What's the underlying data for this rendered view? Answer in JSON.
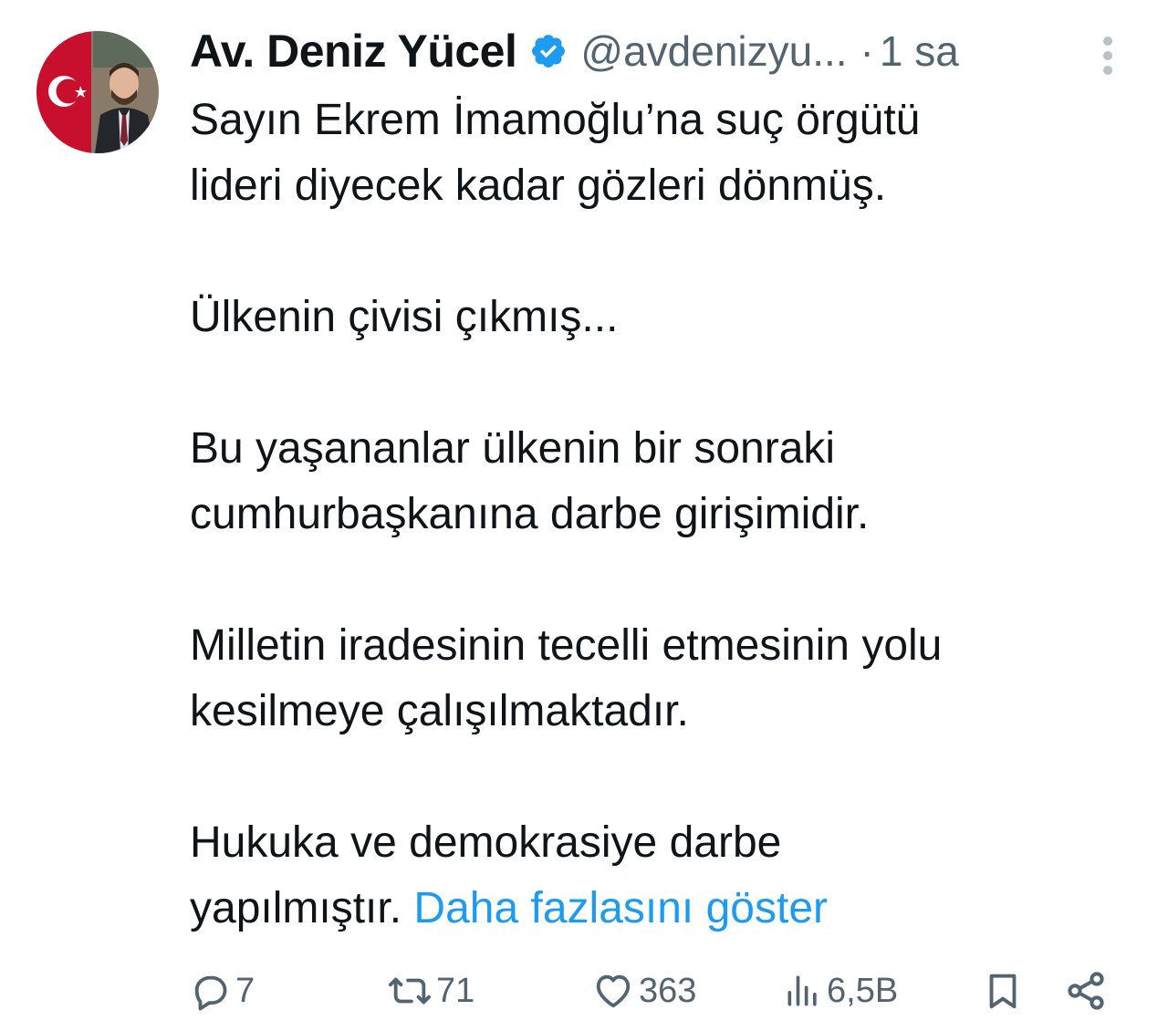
{
  "author": {
    "name": "Av. Deniz Yücel",
    "handle": "@avdenizyu...",
    "separator": "·",
    "time": "1 sa",
    "verified": true,
    "verified_color": "#1d9bf0"
  },
  "tweet": {
    "paragraphs": [
      [
        "Sayın Ekrem İmamoğlu’na suç örgütü",
        "lideri diyecek kadar gözleri dönmüş."
      ],
      [
        "Ülkenin çivisi çıkmış..."
      ],
      [
        "Bu yaşananlar ülkenin bir sonraki",
        "cumhurbaşkanına darbe girişimidir."
      ],
      [
        "Milletin iradesinin tecelli etmesinin yolu",
        "kesilmeye çalışılmaktadır."
      ],
      [
        "Hukuka ve demokrasiye darbe"
      ]
    ],
    "last_line_text": "yapılmıştır.",
    "show_more": "Daha fazlasını göster",
    "link_color": "#1d9bf0"
  },
  "actions": {
    "replies": {
      "icon": "reply-icon",
      "count": "7"
    },
    "reposts": {
      "icon": "repost-icon",
      "count": "71"
    },
    "likes": {
      "icon": "heart-icon",
      "count": "363"
    },
    "views": {
      "icon": "views-icon",
      "count": "6,5B"
    },
    "bookmark": {
      "icon": "bookmark-icon"
    },
    "share": {
      "icon": "share-icon"
    }
  }
}
